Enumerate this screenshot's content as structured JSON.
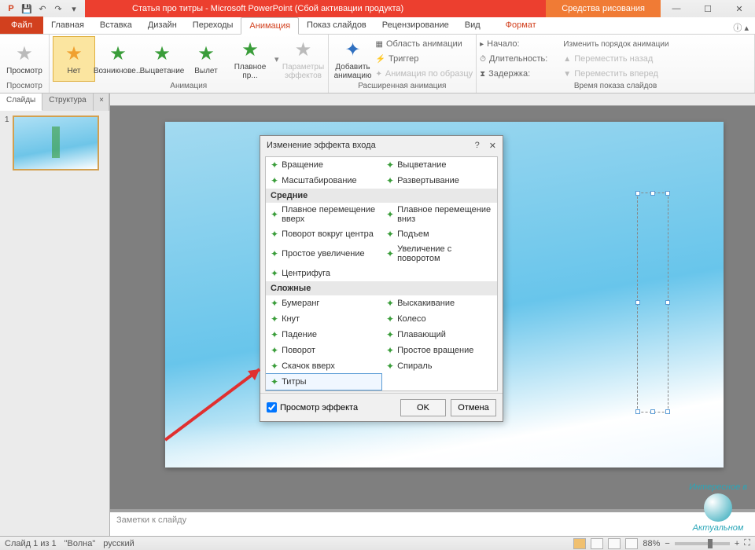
{
  "title": "Статья про титры - Microsoft PowerPoint (Сбой активации продукта)",
  "drawing_tools": "Средства рисования",
  "file_tab": "Файл",
  "tabs": [
    "Главная",
    "Вставка",
    "Дизайн",
    "Переходы",
    "Анимация",
    "Показ слайдов",
    "Рецензирование",
    "Вид"
  ],
  "format_tab": "Формат",
  "ribbon": {
    "preview_group": "Просмотр",
    "preview_btn": "Просмотр",
    "gallery": {
      "none": "Нет",
      "appear": "Возникнове...",
      "fade": "Выцветание",
      "flyin": "Вылет",
      "float": "Плавное пр..."
    },
    "animation_group": "Анимация",
    "effect_opts": "Параметры эффектов",
    "add_anim": "Добавить анимацию",
    "adv_group": "Расширенная анимация",
    "anim_pane": "Область анимации",
    "trigger": "Триггер",
    "by_template": "Анимация по образцу",
    "timing_group": "Время показа слайдов",
    "start": "Начало:",
    "duration": "Длительность:",
    "delay": "Задержка:",
    "reorder": "Изменить порядок анимации",
    "move_up": "Переместить назад",
    "move_down": "Переместить вперед"
  },
  "side": {
    "slides": "Слайды",
    "structure": "Структура",
    "slide_num": "1"
  },
  "notes_placeholder": "Заметки к слайду",
  "status": {
    "slide": "Слайд 1 из 1",
    "theme": "\"Волна\"",
    "lang": "русский",
    "zoom": "88%"
  },
  "dialog": {
    "title": "Изменение эффекта входа",
    "cat_basic_items_left": [
      "Вращение",
      "Масштабирование"
    ],
    "cat_basic_items_right": [
      "Выцветание",
      "Развертывание"
    ],
    "cat_medium": "Средние",
    "cat_medium_left": [
      "Плавное перемещение вверх",
      "Поворот вокруг центра",
      "Простое увеличение",
      "Центрифуга"
    ],
    "cat_medium_right": [
      "Плавное перемещение вниз",
      "Подъем",
      "Увеличение с поворотом"
    ],
    "cat_complex": "Сложные",
    "cat_complex_left": [
      "Бумеранг",
      "Кнут",
      "Падение",
      "Поворот",
      "Скачок вверх",
      "Титры"
    ],
    "cat_complex_right": [
      "Выскакивание",
      "Колесо",
      "Плавающий",
      "Простое вращение",
      "Спираль"
    ],
    "preview": "Просмотр эффекта",
    "ok": "OK",
    "cancel": "Отмена"
  },
  "watermark": {
    "line1": "Интересное в",
    "line2": "Актуальном"
  }
}
